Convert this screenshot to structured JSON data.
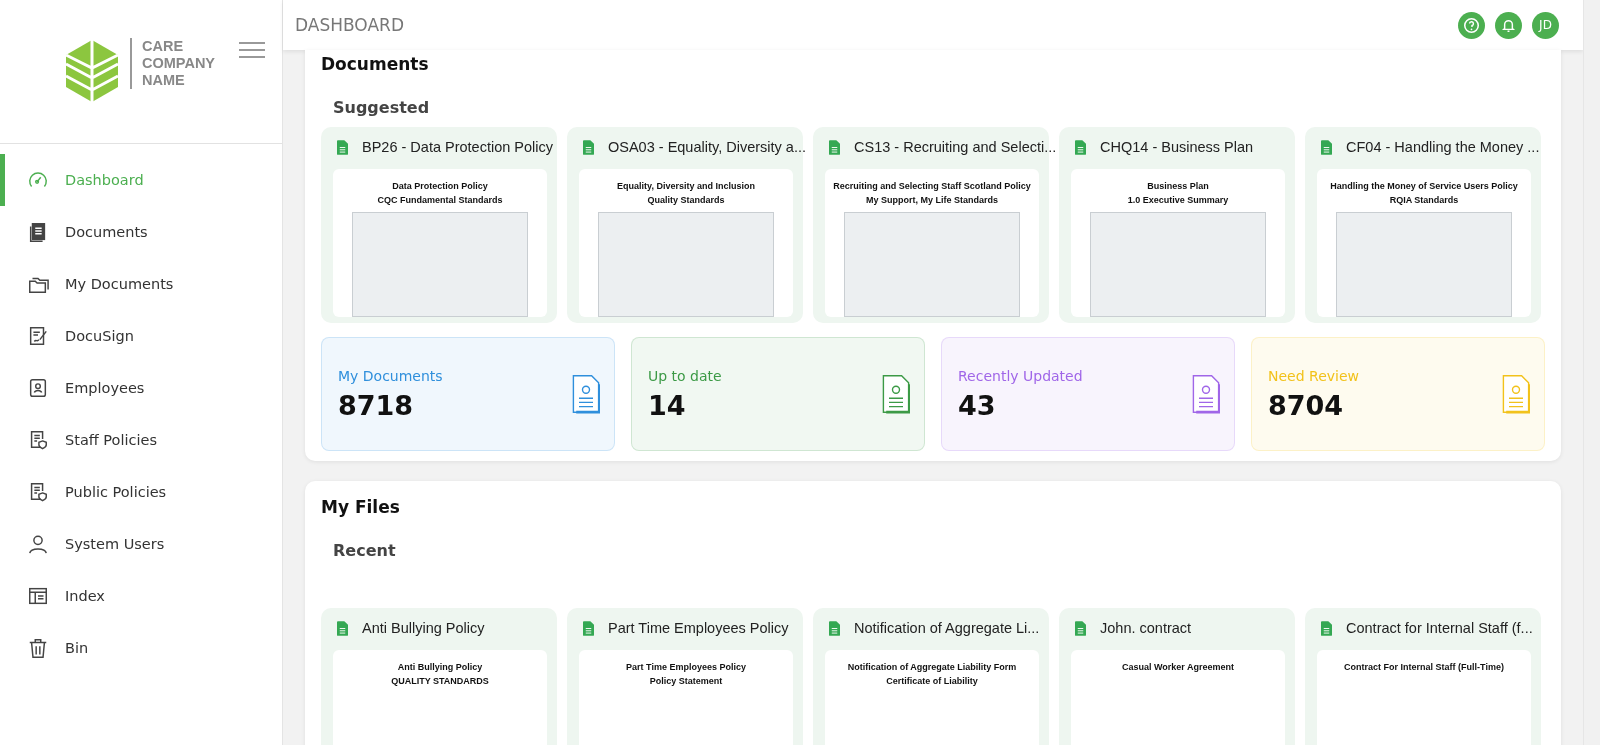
{
  "header": {
    "title": "DASHBOARD",
    "avatar": "JD"
  },
  "brand": {
    "lines": [
      "CARE",
      "COMPANY",
      "NAME"
    ]
  },
  "sidebar": {
    "items": [
      {
        "label": "Dashboard",
        "kind": "gauge",
        "selected": true
      },
      {
        "label": "Documents",
        "kind": "docs",
        "selected": false
      },
      {
        "label": "My Documents",
        "kind": "folders",
        "selected": false
      },
      {
        "label": "DocuSign",
        "kind": "sign",
        "selected": false
      },
      {
        "label": "Employees",
        "kind": "badge",
        "selected": false
      },
      {
        "label": "Staff Policies",
        "kind": "policy",
        "selected": false
      },
      {
        "label": "Public Policies",
        "kind": "policy",
        "selected": false
      },
      {
        "label": "System Users",
        "kind": "user",
        "selected": false
      },
      {
        "label": "Index",
        "kind": "index",
        "selected": false
      },
      {
        "label": "Bin",
        "kind": "bin",
        "selected": false
      }
    ]
  },
  "documents": {
    "title": "Documents",
    "subtitle": "Suggested",
    "cards": [
      {
        "title": "BP26 - Data Protection Policy",
        "preview": [
          "Data Protection Policy",
          "CQC Fundamental Standards"
        ]
      },
      {
        "title": "OSA03 - Equality, Diversity a...",
        "preview": [
          "Equality, Diversity and Inclusion",
          "Quality Standards"
        ]
      },
      {
        "title": "CS13 - Recruiting and Selecti...",
        "preview": [
          "Recruiting and Selecting Staff Scotland Policy",
          "My Support, My Life Standards"
        ]
      },
      {
        "title": "CHQ14 - Business Plan",
        "preview": [
          "Business Plan",
          "1.0 Executive Summary"
        ]
      },
      {
        "title": "CF04 - Handling the Money ...",
        "preview": [
          "Handling the Money of Service Users Policy",
          "RQIA Standards"
        ]
      }
    ]
  },
  "stats": [
    {
      "label": "My Documents",
      "value": "8718",
      "color": "#2f8fdc"
    },
    {
      "label": "Up to date",
      "value": "14",
      "color": "#3c9a46"
    },
    {
      "label": "Recently Updated",
      "value": "43",
      "color": "#a066e8"
    },
    {
      "label": "Need Review",
      "value": "8704",
      "color": "#f2c21b"
    }
  ],
  "my_files": {
    "title": "My Files",
    "subtitle": "Recent",
    "cards": [
      {
        "title": "Anti Bullying Policy",
        "preview": [
          "Anti Bullying Policy",
          "QUALITY STANDARDS"
        ]
      },
      {
        "title": "Part Time Employees Policy",
        "preview": [
          "Part Time Employees Policy",
          "Policy Statement"
        ]
      },
      {
        "title": "Notification of Aggregate Li...",
        "preview": [
          "Notification of Aggregate Liability Form",
          "Certificate of Liability"
        ]
      },
      {
        "title": "John. contract",
        "preview": [
          "Casual Worker Agreement"
        ]
      },
      {
        "title": "Contract for Internal Staff (f...",
        "preview": [
          "Contract For Internal Staff (Full-Time)"
        ]
      }
    ]
  }
}
